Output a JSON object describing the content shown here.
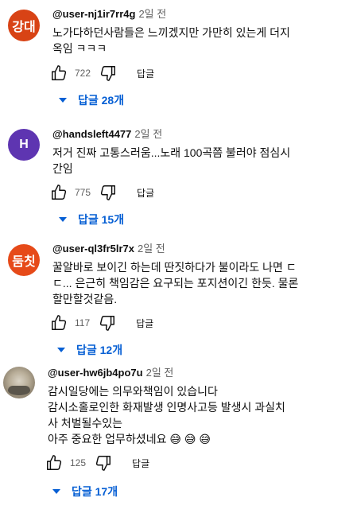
{
  "comments": [
    {
      "avatar_text": "강대",
      "avatar_color": "#d84315",
      "user": "@user-nj1ir7rr4g",
      "time": "2일 전",
      "text_lines": [
        "노가다하던사람들은 느끼겠지만 가만히 있는게 더지",
        "옥임 ㅋㅋㅋ"
      ],
      "likes": "722",
      "reply_label": "답글",
      "replies_label": "답글 28개"
    },
    {
      "avatar_text": "H",
      "avatar_color": "#5e35b1",
      "user": "@handsleft4477",
      "time": "2일 전",
      "text_lines": [
        "저거 진짜 고통스러움...노래 100곡쯤 불러야 점심시",
        "간임"
      ],
      "likes": "775",
      "reply_label": "답글",
      "replies_label": "답글 15개"
    },
    {
      "avatar_text": "둠칫",
      "avatar_color": "#e64a19",
      "user": "@user-ql3fr5lr7x",
      "time": "2일 전",
      "text_lines": [
        "꿀알바로 보이긴 하는데 딴짓하다가 불이라도 나면 ㄷ",
        "ㄷ... 은근히 책임감은 요구되는 포지션이긴 한듯. 물론",
        "할만할것같음."
      ],
      "likes": "117",
      "reply_label": "답글",
      "replies_label": "답글 12개"
    },
    {
      "avatar_text": "",
      "avatar_color": "#b8ad98",
      "user": "@user-hw6jb4po7u",
      "time": "2일 전",
      "text_lines": [
        "감시일당에는 의무와책임이 있습니다",
        "감시소홀로인한 화재발생 인명사고등 발생시 과실치",
        "사 처벌될수있는",
        "아주 중요한 업무하셨네요 😅 😅 😅"
      ],
      "likes": "125",
      "reply_label": "답글",
      "replies_label": "답글 17개"
    }
  ],
  "icons": {
    "like": "thumb-up-icon",
    "dislike": "thumb-down-icon",
    "expand": "caret-down-icon"
  }
}
